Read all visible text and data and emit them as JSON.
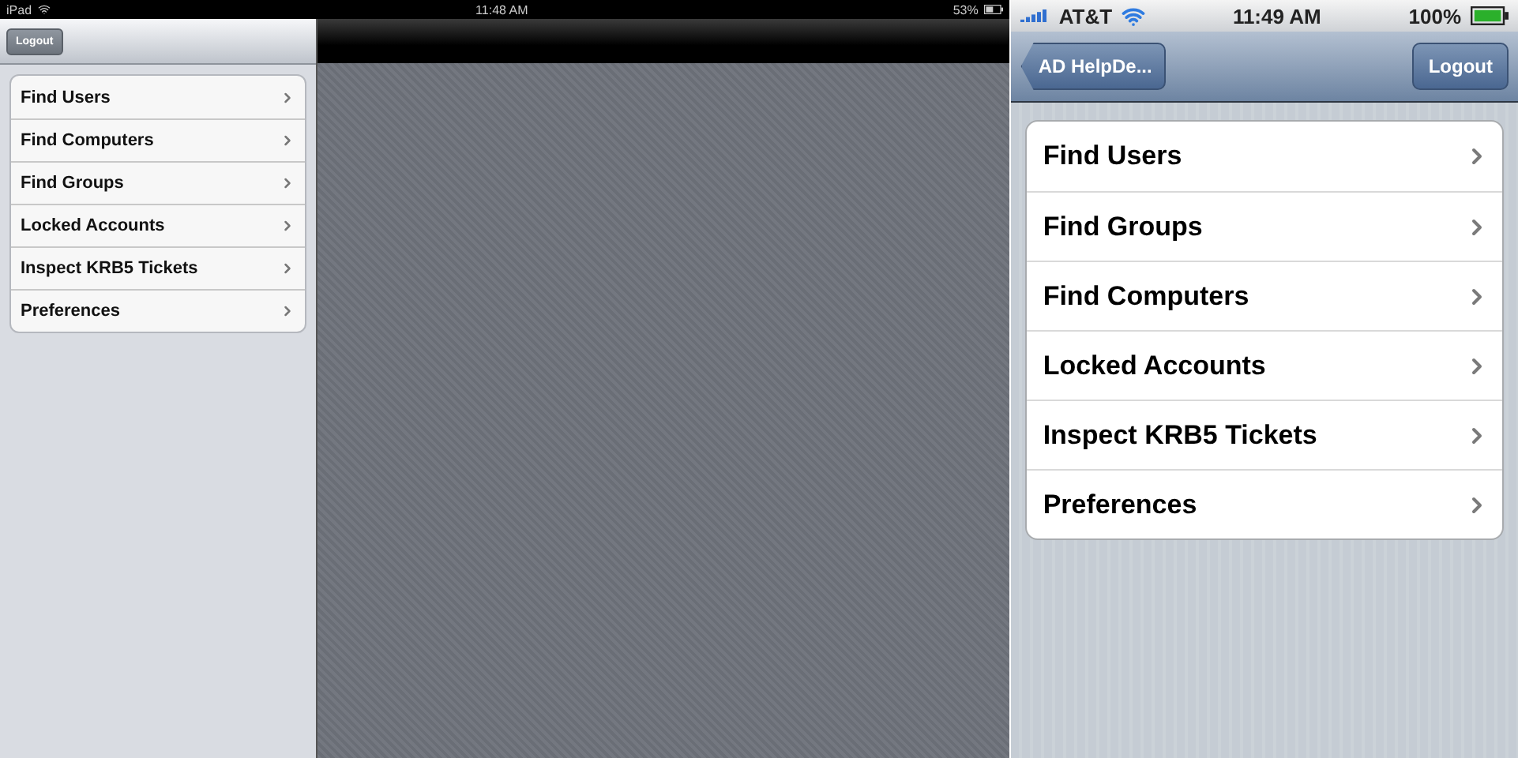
{
  "ipad": {
    "status_bar": {
      "device": "iPad",
      "time": "11:48 AM",
      "battery": "53%"
    },
    "nav_bar": {
      "button": "Logout"
    },
    "menu": [
      {
        "label": "Find Users"
      },
      {
        "label": "Find Computers"
      },
      {
        "label": "Find Groups"
      },
      {
        "label": "Locked Accounts"
      },
      {
        "label": "Inspect KRB5 Tickets"
      },
      {
        "label": "Preferences"
      }
    ]
  },
  "iphone": {
    "status_bar": {
      "carrier": "AT&T",
      "time": "11:49 AM",
      "battery": "100%"
    },
    "nav_bar": {
      "back_button": "AD HelpDe...",
      "button": "Logout"
    },
    "menu": [
      {
        "label": "Find Users"
      },
      {
        "label": "Find Groups"
      },
      {
        "label": "Find Computers"
      },
      {
        "label": "Locked Accounts"
      },
      {
        "label": "Inspect KRB5 Tickets"
      },
      {
        "label": "Preferences"
      }
    ]
  }
}
